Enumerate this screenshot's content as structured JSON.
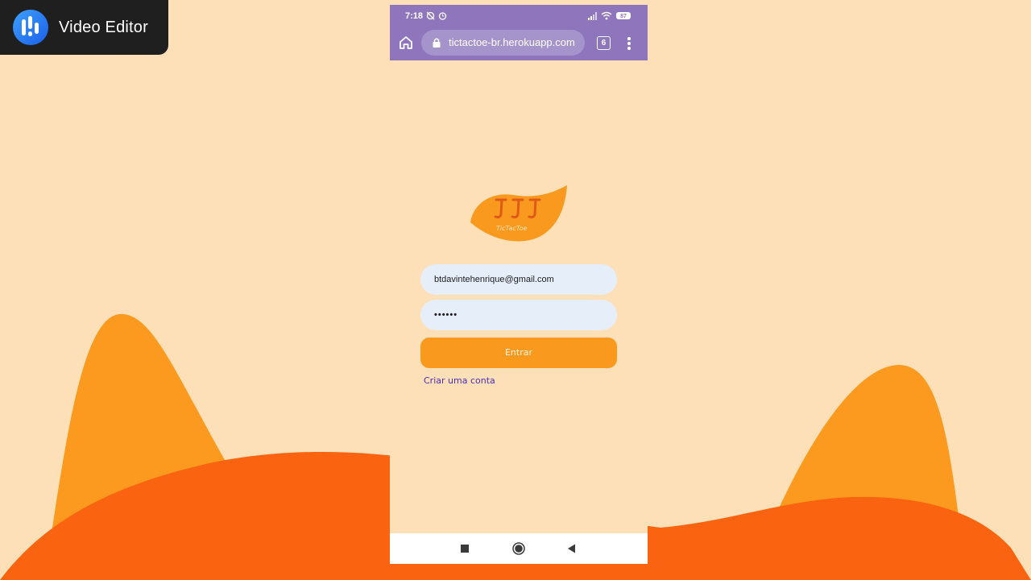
{
  "watermark": {
    "label": "Video Editor",
    "icon": "video-editor-logo-icon"
  },
  "status_bar": {
    "time": "7:18",
    "battery": "87",
    "icons": [
      "sync-off-icon",
      "alarm-icon",
      "signal-icon",
      "wifi-icon",
      "battery-icon"
    ]
  },
  "browser": {
    "url": "tictactoe-br.herokuapp.com",
    "tab_count": "6",
    "icons": [
      "home-icon",
      "lock-icon",
      "tabs-icon",
      "more-vert-icon"
    ]
  },
  "login": {
    "email_value": "btdavintehenrique@gmail.com",
    "password_mask": "••••••",
    "submit_label": "Entrar",
    "signup_label": "Criar uma conta"
  },
  "colors": {
    "background": "#fde0b7",
    "accent_orange": "#f99a1f",
    "deep_orange": "#fa6410",
    "browser_purple": "#8f76bc",
    "link_purple": "#4a2db5",
    "field_bg": "#e6eef9"
  },
  "nav_bar": {
    "icons": [
      "recent-apps-icon",
      "home-circle-icon",
      "back-icon"
    ]
  }
}
